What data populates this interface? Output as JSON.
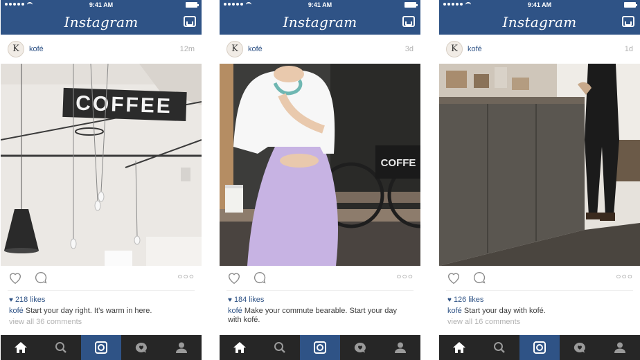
{
  "status_bar": {
    "time": "9:41 AM"
  },
  "app": {
    "title": "Instagram"
  },
  "colors": {
    "brand": "#2f5386",
    "tabbar": "#262626",
    "meta": "#b2b2b2"
  },
  "icons": {
    "header": [
      "inbox-icon"
    ],
    "actions": [
      "heart-icon",
      "comment-icon",
      "more-icon"
    ],
    "tabs": [
      "home-icon",
      "search-icon",
      "camera-icon",
      "activity-icon",
      "profile-icon"
    ]
  },
  "posts": [
    {
      "avatar_letter": "K",
      "username": "kofé",
      "time": "12m",
      "photo_sign": "COFFEE",
      "likes": "218 likes",
      "caption_user": "kofé",
      "caption": "Start your day right. It’s warm in here.",
      "view_all": "view all 36 comments"
    },
    {
      "avatar_letter": "K",
      "username": "kofé",
      "time": "3d",
      "photo_sign": "COFFE",
      "likes": "184 likes",
      "caption_user": "kofé",
      "caption": "Make your commute bearable. Start your day with kofé.",
      "view_all": ""
    },
    {
      "avatar_letter": "K",
      "username": "kofé",
      "time": "1d",
      "photo_sign": "",
      "likes": "126 likes",
      "caption_user": "kofé",
      "caption": "Start your day with kofé.",
      "view_all": "view all 16 comments"
    }
  ],
  "more_glyph": "○○○"
}
